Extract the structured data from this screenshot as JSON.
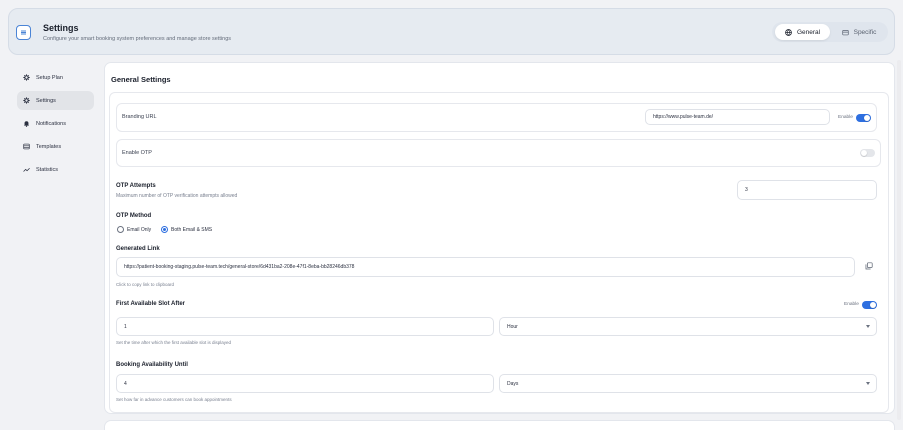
{
  "header": {
    "title": "Settings",
    "subtitle": "Configure your smart booking system preferences and manage store settings",
    "icon": "settings-panel-icon",
    "tabs": [
      {
        "label": "General",
        "icon": "globe-icon",
        "active": true
      },
      {
        "label": "Specific",
        "icon": "store-icon",
        "active": false
      }
    ]
  },
  "sidebar": {
    "items": [
      {
        "label": "Setup Plan",
        "icon": "gear-icon",
        "active": false
      },
      {
        "label": "Settings",
        "icon": "gear-icon",
        "active": true
      },
      {
        "label": "Notifications",
        "icon": "bell-icon",
        "active": false
      },
      {
        "label": "Templates",
        "icon": "list-icon",
        "active": false
      },
      {
        "label": "Statistics",
        "icon": "trend-icon",
        "active": false
      }
    ]
  },
  "main": {
    "title": "General Settings",
    "branding": {
      "label": "Branding URL",
      "value": "https://www.pulse-team.de/",
      "toggle_label": "Enable",
      "enabled": true
    },
    "otp": {
      "label": "Enable OTP",
      "enabled": false
    },
    "otp_attempts": {
      "title": "OTP Attempts",
      "help": "Maximum number of OTP verification attempts allowed",
      "value": "3"
    },
    "otp_method": {
      "title": "OTP Method",
      "options": [
        {
          "label": "Email Only",
          "checked": false
        },
        {
          "label": "Both Email & SMS",
          "checked": true
        }
      ]
    },
    "generated_link": {
      "title": "Generated Link",
      "value": "https://patient-booking-staging.pulse-team.tech/general-store/6d431ba2-208e-47f1-8eba-bb28246db378",
      "help": "Click to copy link to clipboard"
    },
    "first_slot": {
      "title": "First Available Slot After",
      "toggle_label": "Enable",
      "enabled": true,
      "value": "1",
      "unit": "Hour",
      "help": "Set the time after which the first available slot is displayed"
    },
    "availability": {
      "title": "Booking Availability Until",
      "value": "4",
      "unit": "Days",
      "help": "Set how far in advance customers can book appointments"
    }
  },
  "colors": {
    "accent": "#2e6fe0",
    "header_bg": "#e6ebf1",
    "page_bg": "#f1f2f5"
  }
}
